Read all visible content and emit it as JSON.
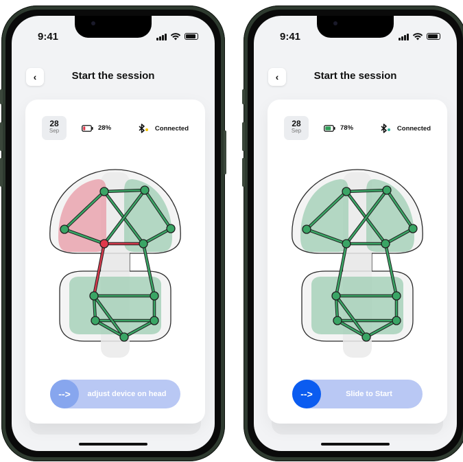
{
  "screens": [
    {
      "status_time": "9:41",
      "title": "Start the session",
      "back_icon": "‹",
      "date_day": "28",
      "date_month": "Sep",
      "battery_pct": "28%",
      "battery_level": 0.28,
      "battery_color": "#e0384b",
      "bt_label": "Connected",
      "bt_dot_color": "#f2c200",
      "slider_label": "adjust device on head",
      "slider_arrow": "-->",
      "slider_knob_color": "#87a6ee",
      "problem_zone": "left-front",
      "accent_green": "#2f9e58",
      "accent_red": "#e0384b"
    },
    {
      "status_time": "9:41",
      "title": "Start the session",
      "back_icon": "‹",
      "date_day": "28",
      "date_month": "Sep",
      "battery_pct": "78%",
      "battery_level": 0.78,
      "battery_color": "#2f9e58",
      "bt_label": "Connected",
      "bt_dot_color": "#2fb39a",
      "slider_label": "Slide to Start",
      "slider_arrow": "-->",
      "slider_knob_color": "#0b5cf0",
      "problem_zone": "none",
      "accent_green": "#2f9e58",
      "accent_red": "#e0384b"
    }
  ]
}
